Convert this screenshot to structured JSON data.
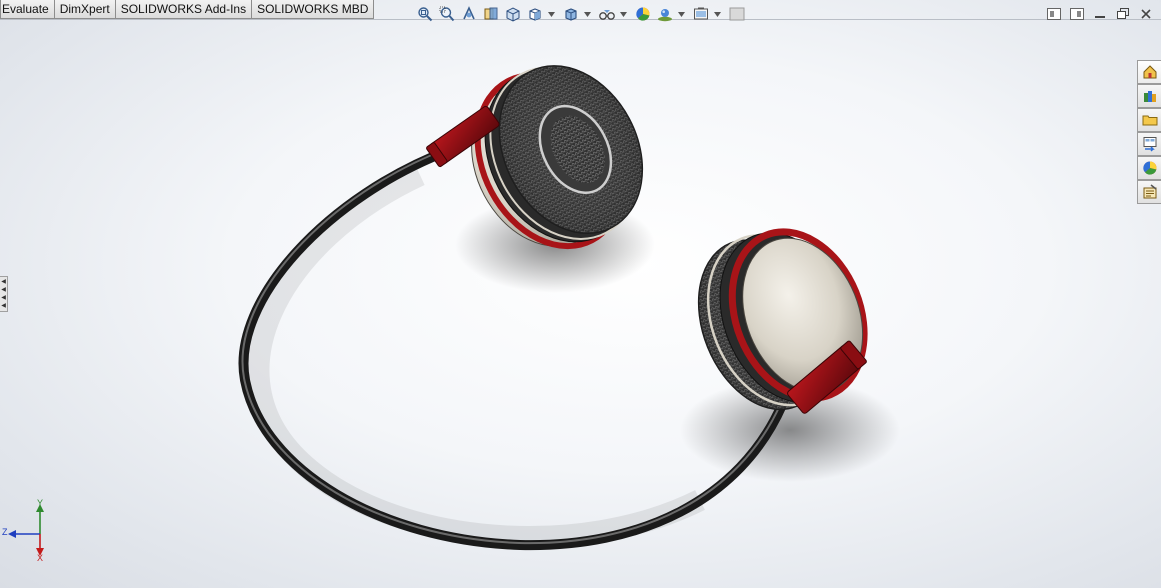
{
  "tabs": [
    {
      "label": "Evaluate"
    },
    {
      "label": "DimXpert"
    },
    {
      "label": "SOLIDWORKS Add-Ins"
    },
    {
      "label": "SOLIDWORKS MBD"
    }
  ],
  "view_toolbar": [
    {
      "icon": "zoom-to-fit-icon",
      "dropdown": false
    },
    {
      "icon": "zoom-to-area-icon",
      "dropdown": false
    },
    {
      "icon": "previous-view-icon",
      "dropdown": false
    },
    {
      "icon": "section-view-icon",
      "dropdown": false
    },
    {
      "icon": "dynamic-annotation-views-icon",
      "dropdown": false
    },
    {
      "icon": "view-orientation-icon",
      "dropdown": true
    },
    {
      "icon": "display-style-icon",
      "dropdown": true
    },
    {
      "icon": "hide-show-items-icon",
      "dropdown": true
    },
    {
      "icon": "edit-appearance-icon",
      "dropdown": false
    },
    {
      "icon": "apply-scene-icon",
      "dropdown": true
    },
    {
      "icon": "view-settings-icon",
      "dropdown": true
    },
    {
      "icon": "display-pane-icon",
      "dropdown": false
    }
  ],
  "window_controls": [
    "tile-left-icon",
    "tile-right-icon",
    "minimize-icon",
    "restore-icon",
    "close-icon"
  ],
  "task_pane": [
    {
      "icon": "solidworks-resources-icon"
    },
    {
      "icon": "design-library-icon"
    },
    {
      "icon": "file-explorer-icon"
    },
    {
      "icon": "view-palette-icon"
    },
    {
      "icon": "appearances-scenes-icon"
    },
    {
      "icon": "custom-properties-icon"
    }
  ],
  "triad": {
    "y": "Y",
    "z": "Z",
    "x": "X"
  },
  "colors": {
    "headband": "#2b2b2b",
    "slider": "#7a0f14",
    "ring": "#a81418",
    "cup_shell": "#d7d2c6",
    "cushion": "#3a3a3a",
    "accent_y": "#2f8a2f",
    "accent_z": "#1f3fbf",
    "accent_x": "#c41a1a"
  }
}
